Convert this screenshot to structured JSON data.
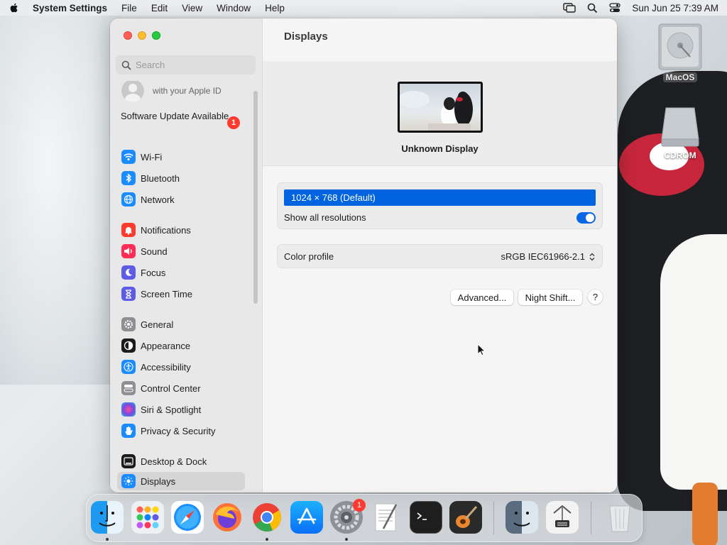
{
  "menubar": {
    "app_name": "System Settings",
    "menus": [
      "File",
      "Edit",
      "View",
      "Window",
      "Help"
    ],
    "clock": "Sun Jun 25  7:39 AM"
  },
  "desktop": {
    "icons": [
      {
        "label": "MacOS"
      },
      {
        "label": "CDROM"
      }
    ]
  },
  "sidebar": {
    "search_placeholder": "Search",
    "apple_id_sub": "with your Apple ID",
    "software_update": "Software Update Available",
    "software_update_badge": "1",
    "items": [
      {
        "label": "Wi-Fi",
        "icon": "wifi-icon",
        "color": "#1a8cff"
      },
      {
        "label": "Bluetooth",
        "icon": "bluetooth-icon",
        "color": "#1a8cff"
      },
      {
        "label": "Network",
        "icon": "globe-icon",
        "color": "#1a8cff"
      },
      {
        "label": "Notifications",
        "icon": "bell-icon",
        "color": "#ff3b30"
      },
      {
        "label": "Sound",
        "icon": "speaker-icon",
        "color": "#ff2d55"
      },
      {
        "label": "Focus",
        "icon": "moon-icon",
        "color": "#5e5ce6"
      },
      {
        "label": "Screen Time",
        "icon": "hourglass-icon",
        "color": "#5e5ce6"
      },
      {
        "label": "General",
        "icon": "gear-icon",
        "color": "#8e8e93"
      },
      {
        "label": "Appearance",
        "icon": "appearance-icon",
        "color": "#1c1c1e"
      },
      {
        "label": "Accessibility",
        "icon": "accessibility-icon",
        "color": "#1a8cff"
      },
      {
        "label": "Control Center",
        "icon": "control-center-icon",
        "color": "#8e8e93"
      },
      {
        "label": "Siri & Spotlight",
        "icon": "siri-icon",
        "color": "#c048c8"
      },
      {
        "label": "Privacy & Security",
        "icon": "hand-icon",
        "color": "#1a8cff"
      },
      {
        "label": "Desktop & Dock",
        "icon": "dock-icon",
        "color": "#1c1c1e"
      },
      {
        "label": "Displays",
        "icon": "sun-icon",
        "color": "#1a8cff"
      }
    ]
  },
  "content": {
    "title": "Displays",
    "display_name": "Unknown Display",
    "resolution_selected": "1024 × 768 (Default)",
    "show_all_resolutions_label": "Show all resolutions",
    "show_all_resolutions": true,
    "color_profile_label": "Color profile",
    "color_profile_value": "sRGB IEC61966-2.1",
    "advanced_button": "Advanced...",
    "night_shift_button": "Night Shift...",
    "help_button": "?"
  },
  "dock": {
    "apps": [
      {
        "name": "Finder",
        "running": true
      },
      {
        "name": "Launchpad",
        "running": false
      },
      {
        "name": "Safari",
        "running": false
      },
      {
        "name": "Firefox",
        "running": false
      },
      {
        "name": "Chrome",
        "running": true
      },
      {
        "name": "App Store",
        "running": false
      },
      {
        "name": "System Settings",
        "running": true,
        "badge": "1"
      },
      {
        "name": "TextEdit",
        "running": false
      },
      {
        "name": "Terminal",
        "running": false
      },
      {
        "name": "GarageBand",
        "running": false
      },
      {
        "name": "Finder Folder",
        "running": false
      },
      {
        "name": "Preview",
        "running": false
      },
      {
        "name": "Trash",
        "running": false
      }
    ]
  }
}
